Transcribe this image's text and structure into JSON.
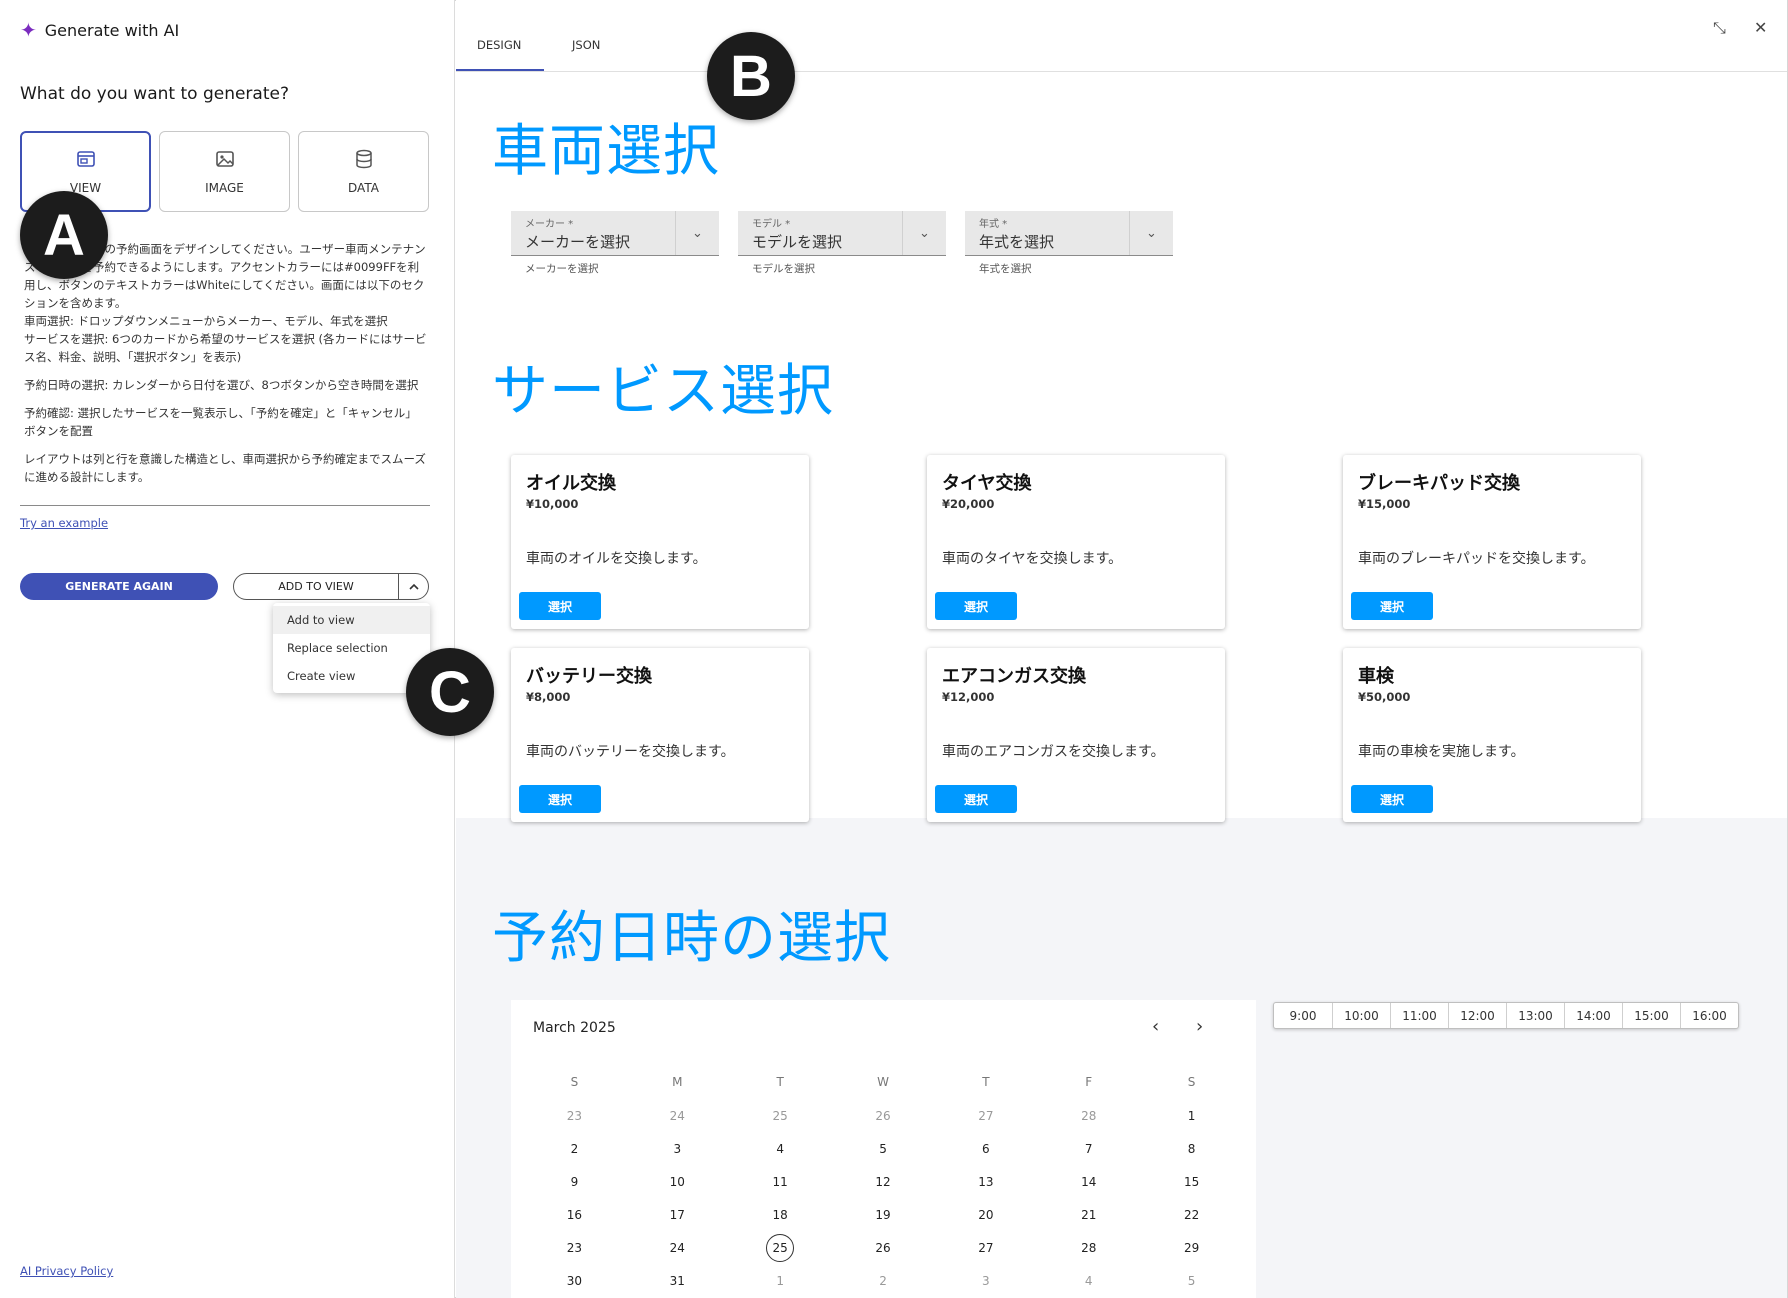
{
  "left_panel": {
    "header_title": "Generate with AI",
    "question": "What do you want to generate?",
    "types": [
      {
        "label": "VIEW",
        "icon": "view-icon"
      },
      {
        "label": "IMAGE",
        "icon": "image-icon"
      },
      {
        "label": "DATA",
        "icon": "database-icon"
      }
    ],
    "prompt_paragraphs": [
      "ップ向けアプリの予約画面をデザインしてください。ユーザー車両メンテナンスサービスを予約できるようにします。アクセントカラーには#0099FFを利用し、ボタンのテキストカラーはWhiteにしてください。画面には以下のセクションを含めます。",
      "車両選択: ドロップダウンメニューからメーカー、モデル、年式を選択",
      "サービスを選択: 6つのカードから希望のサービスを選択 (各カードにはサービス名、料金、説明、「選択ボタン」を表示)",
      "予約日時の選択: カレンダーから日付を選び、8つボタンから空き時間を選択",
      "予約確認: 選択したサービスを一覧表示し、「予約を確定」と「キャンセル」ボタンを配置",
      "レイアウトは列と行を意識した構造とし、車両選択から予約確定までスムーズに進める設計にします。"
    ],
    "try_example": "Try an example",
    "generate_again": "GENERATE AGAIN",
    "add_to_view": "ADD TO VIEW",
    "menu": [
      "Add to view",
      "Replace selection",
      "Create view"
    ],
    "privacy": "AI Privacy Policy"
  },
  "markers": {
    "a": "A",
    "b": "B",
    "c": "C"
  },
  "tabs": {
    "design": "DESIGN",
    "json": "JSON"
  },
  "window": {
    "collapse": "⤡",
    "close": "✕"
  },
  "vehicle": {
    "title": "車両選択",
    "selects": [
      {
        "label": "メーカー *",
        "value": "メーカーを選択",
        "help": "メーカーを選択"
      },
      {
        "label": "モデル *",
        "value": "モデルを選択",
        "help": "モデルを選択"
      },
      {
        "label": "年式 *",
        "value": "年式を選択",
        "help": "年式を選択"
      }
    ]
  },
  "services": {
    "title": "サービス選択",
    "button": "選択",
    "cards": [
      {
        "name": "オイル交換",
        "price": "¥10,000",
        "desc": "車両のオイルを交換します。"
      },
      {
        "name": "タイヤ交換",
        "price": "¥20,000",
        "desc": "車両のタイヤを交換します。"
      },
      {
        "name": "ブレーキパッド交換",
        "price": "¥15,000",
        "desc": "車両のブレーキパッドを交換します。"
      },
      {
        "name": "バッテリー交換",
        "price": "¥8,000",
        "desc": "車両のバッテリーを交換します。"
      },
      {
        "name": "エアコンガス交換",
        "price": "¥12,000",
        "desc": "車両のエアコンガスを交換します。"
      },
      {
        "name": "車検",
        "price": "¥50,000",
        "desc": "車両の車検を実施します。"
      }
    ]
  },
  "booking": {
    "title": "予約日時の選択",
    "month": "March 2025",
    "weekdays": [
      "S",
      "M",
      "T",
      "W",
      "T",
      "F",
      "S"
    ],
    "weeks": [
      [
        "23",
        "24",
        "25",
        "26",
        "27",
        "28",
        "1"
      ],
      [
        "2",
        "3",
        "4",
        "5",
        "6",
        "7",
        "8"
      ],
      [
        "9",
        "10",
        "11",
        "12",
        "13",
        "14",
        "15"
      ],
      [
        "16",
        "17",
        "18",
        "19",
        "20",
        "21",
        "22"
      ],
      [
        "23",
        "24",
        "25",
        "26",
        "27",
        "28",
        "29"
      ],
      [
        "30",
        "31",
        "1",
        "2",
        "3",
        "4",
        "5"
      ]
    ],
    "today": "25",
    "times": [
      "9:00",
      "10:00",
      "11:00",
      "12:00",
      "13:00",
      "14:00",
      "15:00",
      "16:00"
    ]
  },
  "colors": {
    "accent": "#0099ff",
    "primary": "#3f51b5"
  }
}
